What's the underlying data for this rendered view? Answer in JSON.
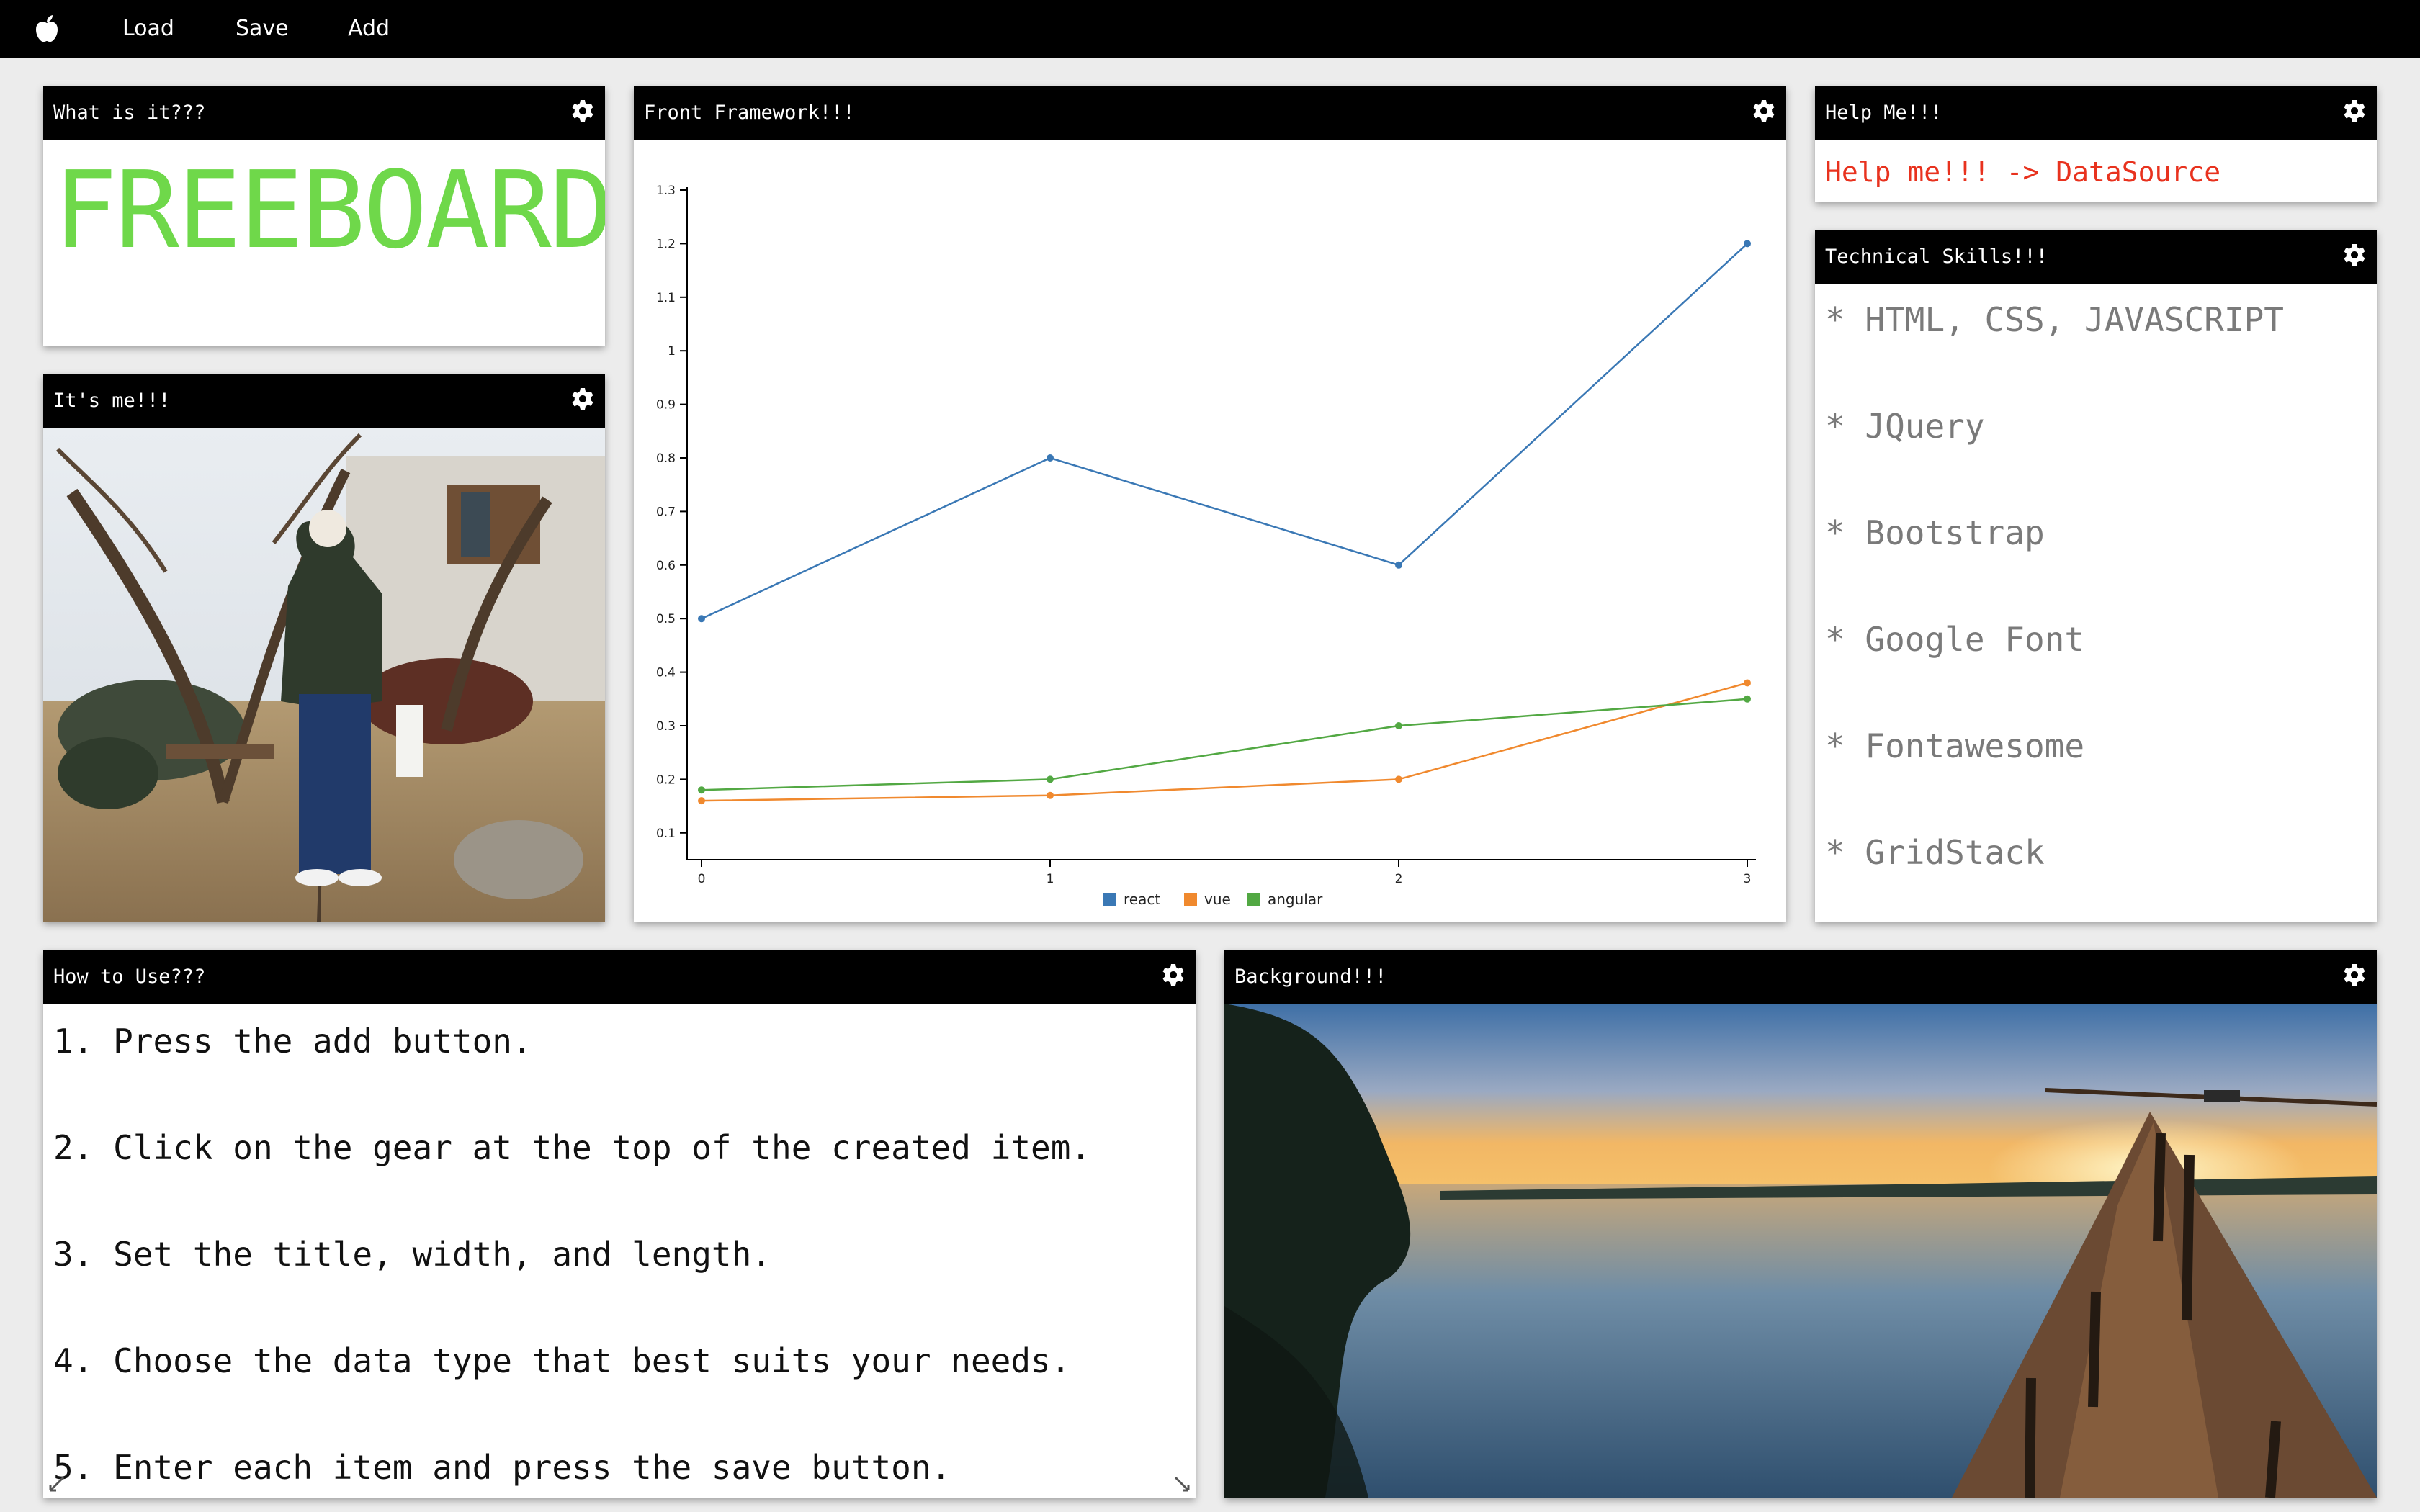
{
  "menu": {
    "logo_icon": "apple-icon",
    "items": [
      "Load",
      "Save",
      "Add"
    ]
  },
  "widgets": {
    "what": {
      "title": "What is it???",
      "content": "FREEBOARD",
      "content_color": "#6fd84a"
    },
    "me": {
      "title": "It's me!!!"
    },
    "framework": {
      "title": "Front Framework!!!"
    },
    "help": {
      "title": "Help Me!!!",
      "link": "Help me!!! -> DataSource",
      "link_color": "#e8321e"
    },
    "skills": {
      "title": "Technical Skills!!!",
      "items": [
        "* HTML, CSS, JAVASCRIPT",
        "* JQuery",
        "* Bootstrap",
        "* Google Font",
        "* Fontawesome",
        "* GridStack"
      ]
    },
    "howto": {
      "title": "How to Use???",
      "steps": [
        "1. Press the add button.",
        "2. Click on the gear at the top of the created item.",
        "3. Set the title, width, and length.",
        "4. Choose the data type that best suits your needs.",
        "5. Enter each item and press the save button."
      ]
    },
    "background": {
      "title": "Background!!!"
    }
  },
  "icons": {
    "widget_settings": "gear-icon",
    "resize_handle": "resize-handle-icon"
  },
  "chart_data": {
    "type": "line",
    "x": [
      0,
      1,
      2,
      3
    ],
    "series": [
      {
        "name": "react",
        "color": "#3a78b5",
        "values": [
          0.5,
          0.8,
          0.6,
          1.2
        ]
      },
      {
        "name": "vue",
        "color": "#f0892e",
        "values": [
          0.16,
          0.17,
          0.2,
          0.38
        ]
      },
      {
        "name": "angular",
        "color": "#52a843",
        "values": [
          0.18,
          0.2,
          0.3,
          0.35
        ]
      }
    ],
    "xlim": [
      0,
      3
    ],
    "ylim": [
      0.05,
      1.3
    ],
    "xticks": [
      "0",
      "1",
      "2",
      "3"
    ],
    "yticks": [
      "0.1",
      "0.2",
      "0.3",
      "0.4",
      "0.5",
      "0.6",
      "0.7",
      "0.8",
      "0.9",
      "1",
      "1.1",
      "1.2",
      "1.3"
    ],
    "legend": "bottom-center",
    "grid": false
  }
}
